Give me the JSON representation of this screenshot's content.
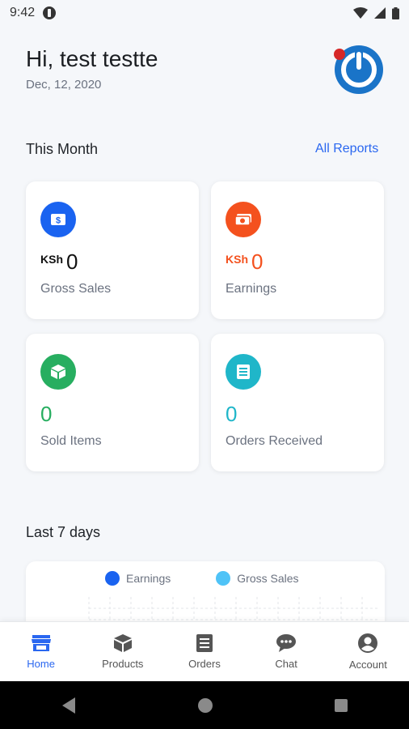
{
  "status_bar": {
    "time": "9:42"
  },
  "greeting": {
    "title": "Hi, test testte",
    "date": "Dec, 12, 2020"
  },
  "this_month": {
    "title": "This Month",
    "all_reports": "All Reports",
    "cards": [
      {
        "currency": "KSh",
        "value": "0",
        "label": "Gross Sales",
        "icon": "dollar-icon",
        "color": "#1a63f0"
      },
      {
        "currency": "KSh",
        "value": "0",
        "label": "Earnings",
        "icon": "cash-icon",
        "color": "#f4511e"
      },
      {
        "value": "0",
        "label": "Sold Items",
        "icon": "box-icon",
        "color": "#27ae60"
      },
      {
        "value": "0",
        "label": "Orders Received",
        "icon": "receipt-icon",
        "color": "#1fb6c9"
      }
    ]
  },
  "last_7_days": {
    "title": "Last 7 days",
    "legend": [
      {
        "label": "Earnings",
        "color": "#1a63f0"
      },
      {
        "label": "Gross Sales",
        "color": "#4fc3f7"
      }
    ]
  },
  "bottom_nav": {
    "items": [
      {
        "label": "Home",
        "icon": "store-icon",
        "active": true
      },
      {
        "label": "Products",
        "icon": "box-icon"
      },
      {
        "label": "Orders",
        "icon": "list-icon"
      },
      {
        "label": "Chat",
        "icon": "chat-icon"
      },
      {
        "label": "Account",
        "icon": "account-icon"
      }
    ]
  },
  "colors": {
    "accent": "#2a67f0",
    "earnings": "#f4511e",
    "green": "#27ae60",
    "teal": "#1fb6c9"
  }
}
